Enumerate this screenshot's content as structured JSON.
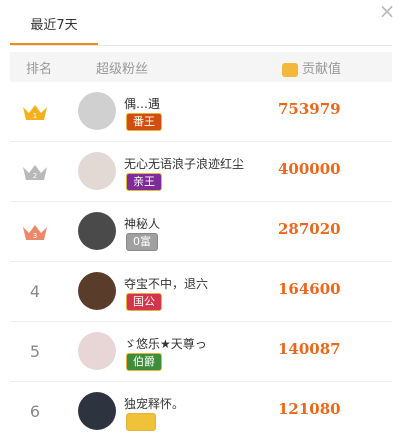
{
  "tab": {
    "label": "最近7天"
  },
  "header": {
    "rank": "排名",
    "fans": "超级粉丝",
    "contribution": "贡献值"
  },
  "rows": [
    {
      "rank": "",
      "rank_num": "1",
      "crown_color": "#f3b21b",
      "nickname": "偶…遇",
      "badge": "番王",
      "badge_color": "#d04f10",
      "value": "753979",
      "avatar_color": "#c9c9c9"
    },
    {
      "rank": "",
      "rank_num": "2",
      "crown_color": "#b9b9b9",
      "nickname": "无心无语浪子浪迹红尘",
      "badge": "亲王",
      "badge_color": "#7d2c98",
      "value": "400000",
      "avatar_color": "#e2d9d4"
    },
    {
      "rank": "",
      "rank_num": "3",
      "crown_color": "#e9896a",
      "nickname": "神秘人",
      "badge": "0富",
      "badge_color": "#a0a0a0",
      "value": "287020",
      "avatar_color": "#4a4a4a"
    },
    {
      "rank": "4",
      "nickname": "夺宝不中，退六",
      "badge": "国公",
      "badge_color": "#d4344c",
      "value": "164600",
      "avatar_color": "#5a3c2a"
    },
    {
      "rank": "5",
      "nickname": "ゞ悠乐★天尊っ",
      "badge": "伯爵",
      "badge_color": "#3f8d3a",
      "value": "140087",
      "avatar_color": "#e8d5d5"
    },
    {
      "rank": "6",
      "nickname": "独宠释怀。",
      "badge": "",
      "badge_color": "#f0c23a",
      "value": "121080",
      "avatar_color": "#2e3340"
    }
  ]
}
